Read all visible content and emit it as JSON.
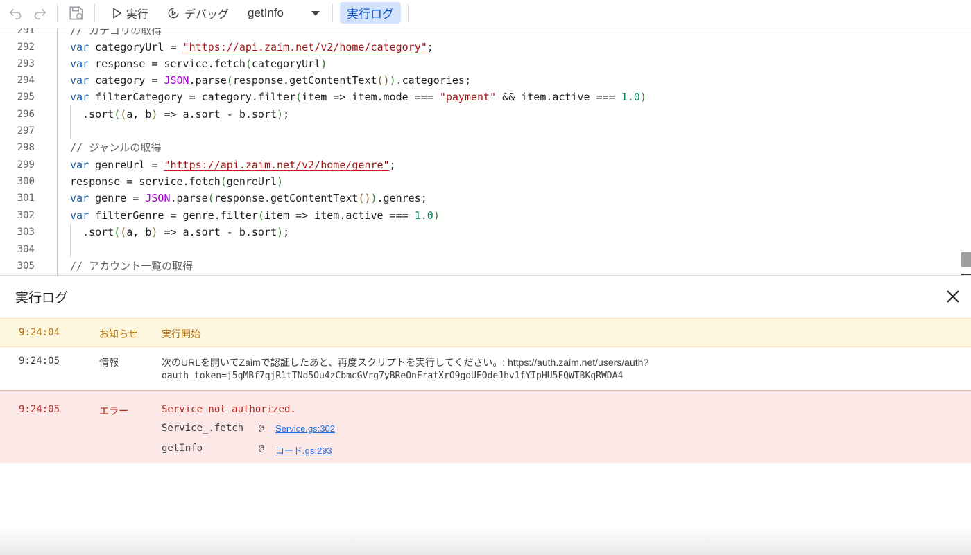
{
  "toolbar": {
    "run_label": "実行",
    "debug_label": "デバッグ",
    "function_name": "getInfo",
    "exec_log_label": "実行ログ"
  },
  "editor": {
    "line_numbers": [
      "291",
      "292",
      "293",
      "294",
      "295",
      "296",
      "297",
      "298",
      "299",
      "300",
      "301",
      "302",
      "303",
      "304",
      "305"
    ],
    "line_291_comment": "// カテゴリの取得",
    "comment_298": "// ジャンルの取得",
    "comment_305": "// アカウント一覧の取得",
    "category_url": "\"https://api.zaim.net/v2/home/category\"",
    "genre_url": "\"https://api.zaim.net/v2/home/genre\"",
    "payment_str": "\"payment\"",
    "num_one": "1.0"
  },
  "log": {
    "title": "実行ログ",
    "entries": [
      {
        "time": "9:24:04",
        "level": "お知らせ",
        "message": "実行開始"
      },
      {
        "time": "9:24:05",
        "level": "情報",
        "message_line1": "次のURLを開いてZaimで認証したあと、再度スクリプトを実行してください。: https://auth.zaim.net/users/auth?",
        "message_line2": "oauth_token=j5qMBf7qjR1tTNd5Ou4zCbmcGVrg7yBReOnFratXrO9goUEOdeJhv1fYIpHU5FQWTBKqRWDA4"
      },
      {
        "time": "9:24:05",
        "level": "エラー",
        "message": "Service not authorized.",
        "stack": [
          {
            "fn": "Service_.fetch",
            "at": "@",
            "loc": "Service.gs:302"
          },
          {
            "fn": "getInfo",
            "at": "@",
            "loc": "コード.gs:293"
          }
        ]
      }
    ]
  }
}
